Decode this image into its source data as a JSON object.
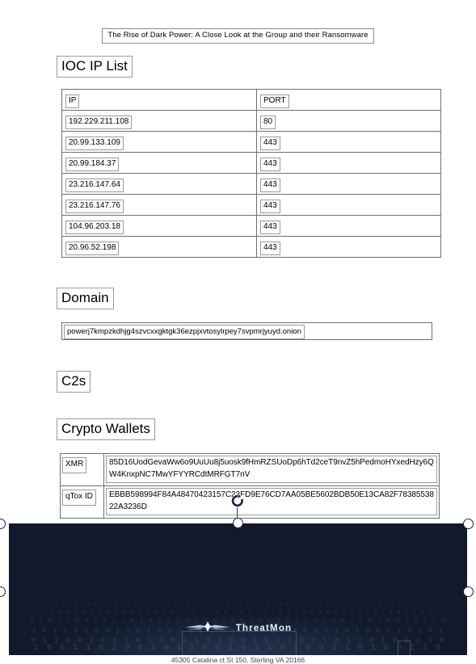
{
  "document": {
    "title": "The Rise of Dark Power: A Close Look at the Group and their Ransomware"
  },
  "sections": {
    "ioc_ip_list": {
      "heading": "IOC IP List",
      "columns": [
        "IP",
        "PORT"
      ],
      "rows": [
        {
          "ip": "192.229.211.108",
          "port": "80"
        },
        {
          "ip": "20.99.133.109",
          "port": "443"
        },
        {
          "ip": "20.99.184.37",
          "port": "443"
        },
        {
          "ip": "23.216.147.64",
          "port": "443"
        },
        {
          "ip": "23.216.147.76",
          "port": "443"
        },
        {
          "ip": "104.96.203.18",
          "port": "443"
        },
        {
          "ip": "20.96.52.198",
          "port": "443"
        }
      ]
    },
    "domain": {
      "heading": "Domain",
      "value": "powerj7kmpzkdhjg4szvcxxgktgk36ezpjxvtosylrpey7svpmrjyuyd.onion"
    },
    "c2s": {
      "heading": "C2s"
    },
    "crypto_wallets": {
      "heading": "Crypto Wallets",
      "rows": [
        {
          "label": "XMR",
          "value": "85D16UodGevaWw6o9UuUu8j5uosk9fHmRZSUoDp6hTd2ceT9nvZ5hPedmoHYxedHzy6QW4KnxpNC7MwYFYYRCdtMRFGT7nV"
        },
        {
          "label": "qTox ID",
          "value": "EBBB598994F84A48470423157C23FD9E76CD7AA05BE5602BDB50E13CA82F7838553822A3236D"
        }
      ]
    }
  },
  "footer": {
    "brand": "ThreatMon",
    "address": "45305 Catalina ct St 150, Sterling VA 20166",
    "background_color": "#111a2b",
    "binary_rows": [
      "1 0 1 1 0 0 1 0 1 1 1 0 0 1 0 1 1 0 0 1 0 1 1 0 1 0 0 1 1 0 1 0 0 1 1 0 1 0 0 1 0 1 1 0 0 1 0 1 1 0 1 0 0 1 1 0 1 0 0 1",
      "0 1 1 0 1 0 0 1 1 0 1 1 0 0 1 0 1 1 0 1 0 0 1 1 0 1 0 0 1 1 0 1 0 1 0 0 1 1 0 1 1 0 0 1 0 1 1 0 1 0 0 1 1 0 1 0",
      "1 1 0 0 1 0 1 1 0 1 0 0 1 1 0 1 0 0 1 0 1 1 0 0 1 0 1 1 0 1 0 0 1 1 0 1 0 0 1 1 0 1 0 1 0 0 1 1 0 1",
      "0 1 0 1 1 0 0 1 0 1 1 0 1 0 0 1 1 0 1 0 0 1 0 1 1 0 0 1 0 1 1 0 1 0 0 1 1 0 1 0 0 1 0 1 1 0",
      "1 0 1 1 0 1 0 0 1 1 0 1 0 0 1 0 1 1 0 0 1 0 1 1 0 1 0 0 1 1 0 1 0 0 1 1 0 1 0 1",
      "0 1 1 0 0 1 0 1 1 0 1 0 0 1 1 0 1 0 0 1 0 1 1 0 0 1 0 1 1 0 1 0 0 1 1 0",
      "1 0 0 1 1 0 1 0 0 1 0 1 1 0 0 1 0 1 1 0 1 0 0 1 1 0 1 0 0 1 1 0"
    ]
  }
}
